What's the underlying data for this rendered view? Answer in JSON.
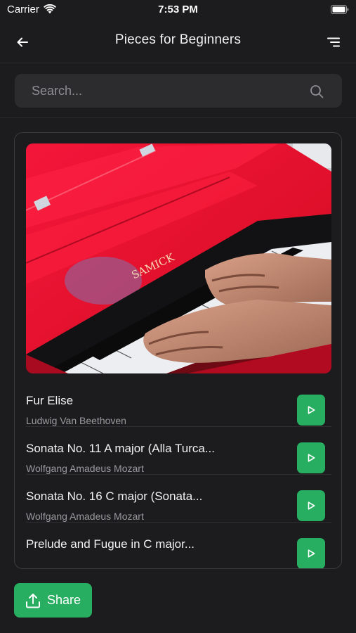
{
  "status_bar": {
    "carrier": "Carrier",
    "time": "7:53 PM"
  },
  "nav": {
    "title": "Pieces for Beginners",
    "back_icon": "arrow-left-icon",
    "menu_icon": "menu-lines-icon"
  },
  "search": {
    "placeholder": "Search...",
    "value": "",
    "icon": "search-icon"
  },
  "card": {
    "image_alt_text_on_piano": "SAMICK",
    "pieces": [
      {
        "title": "Fur Elise",
        "composer": "Ludwig Van Beethoven"
      },
      {
        "title": "Sonata No. 11 A major (Alla Turca...",
        "composer": "Wolfgang Amadeus Mozart"
      },
      {
        "title": "Sonata No. 16 C major (Sonata...",
        "composer": "Wolfgang Amadeus Mozart"
      },
      {
        "title": "Prelude and Fugue in C major...",
        "composer": ""
      }
    ]
  },
  "share": {
    "label": "Share",
    "icon": "upload-icon"
  },
  "colors": {
    "background": "#1c1c1e",
    "accent": "#27ae60",
    "field": "#2c2c2e",
    "piano_red": "#e8112d"
  }
}
